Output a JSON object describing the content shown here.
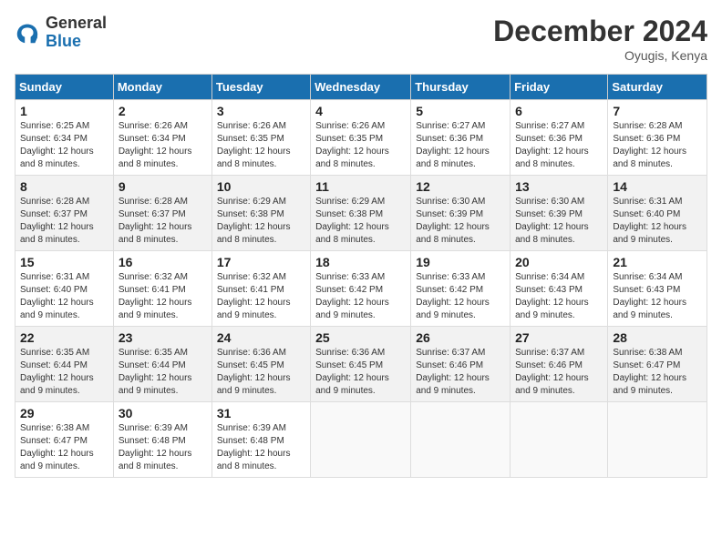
{
  "logo": {
    "general": "General",
    "blue": "Blue"
  },
  "title": "December 2024",
  "location": "Oyugis, Kenya",
  "days_of_week": [
    "Sunday",
    "Monday",
    "Tuesday",
    "Wednesday",
    "Thursday",
    "Friday",
    "Saturday"
  ],
  "weeks": [
    [
      {
        "day": "1",
        "sunrise": "6:25 AM",
        "sunset": "6:34 PM",
        "daylight": "12 hours and 8 minutes."
      },
      {
        "day": "2",
        "sunrise": "6:26 AM",
        "sunset": "6:34 PM",
        "daylight": "12 hours and 8 minutes."
      },
      {
        "day": "3",
        "sunrise": "6:26 AM",
        "sunset": "6:35 PM",
        "daylight": "12 hours and 8 minutes."
      },
      {
        "day": "4",
        "sunrise": "6:26 AM",
        "sunset": "6:35 PM",
        "daylight": "12 hours and 8 minutes."
      },
      {
        "day": "5",
        "sunrise": "6:27 AM",
        "sunset": "6:36 PM",
        "daylight": "12 hours and 8 minutes."
      },
      {
        "day": "6",
        "sunrise": "6:27 AM",
        "sunset": "6:36 PM",
        "daylight": "12 hours and 8 minutes."
      },
      {
        "day": "7",
        "sunrise": "6:28 AM",
        "sunset": "6:36 PM",
        "daylight": "12 hours and 8 minutes."
      }
    ],
    [
      {
        "day": "8",
        "sunrise": "6:28 AM",
        "sunset": "6:37 PM",
        "daylight": "12 hours and 8 minutes."
      },
      {
        "day": "9",
        "sunrise": "6:28 AM",
        "sunset": "6:37 PM",
        "daylight": "12 hours and 8 minutes."
      },
      {
        "day": "10",
        "sunrise": "6:29 AM",
        "sunset": "6:38 PM",
        "daylight": "12 hours and 8 minutes."
      },
      {
        "day": "11",
        "sunrise": "6:29 AM",
        "sunset": "6:38 PM",
        "daylight": "12 hours and 8 minutes."
      },
      {
        "day": "12",
        "sunrise": "6:30 AM",
        "sunset": "6:39 PM",
        "daylight": "12 hours and 8 minutes."
      },
      {
        "day": "13",
        "sunrise": "6:30 AM",
        "sunset": "6:39 PM",
        "daylight": "12 hours and 8 minutes."
      },
      {
        "day": "14",
        "sunrise": "6:31 AM",
        "sunset": "6:40 PM",
        "daylight": "12 hours and 9 minutes."
      }
    ],
    [
      {
        "day": "15",
        "sunrise": "6:31 AM",
        "sunset": "6:40 PM",
        "daylight": "12 hours and 9 minutes."
      },
      {
        "day": "16",
        "sunrise": "6:32 AM",
        "sunset": "6:41 PM",
        "daylight": "12 hours and 9 minutes."
      },
      {
        "day": "17",
        "sunrise": "6:32 AM",
        "sunset": "6:41 PM",
        "daylight": "12 hours and 9 minutes."
      },
      {
        "day": "18",
        "sunrise": "6:33 AM",
        "sunset": "6:42 PM",
        "daylight": "12 hours and 9 minutes."
      },
      {
        "day": "19",
        "sunrise": "6:33 AM",
        "sunset": "6:42 PM",
        "daylight": "12 hours and 9 minutes."
      },
      {
        "day": "20",
        "sunrise": "6:34 AM",
        "sunset": "6:43 PM",
        "daylight": "12 hours and 9 minutes."
      },
      {
        "day": "21",
        "sunrise": "6:34 AM",
        "sunset": "6:43 PM",
        "daylight": "12 hours and 9 minutes."
      }
    ],
    [
      {
        "day": "22",
        "sunrise": "6:35 AM",
        "sunset": "6:44 PM",
        "daylight": "12 hours and 9 minutes."
      },
      {
        "day": "23",
        "sunrise": "6:35 AM",
        "sunset": "6:44 PM",
        "daylight": "12 hours and 9 minutes."
      },
      {
        "day": "24",
        "sunrise": "6:36 AM",
        "sunset": "6:45 PM",
        "daylight": "12 hours and 9 minutes."
      },
      {
        "day": "25",
        "sunrise": "6:36 AM",
        "sunset": "6:45 PM",
        "daylight": "12 hours and 9 minutes."
      },
      {
        "day": "26",
        "sunrise": "6:37 AM",
        "sunset": "6:46 PM",
        "daylight": "12 hours and 9 minutes."
      },
      {
        "day": "27",
        "sunrise": "6:37 AM",
        "sunset": "6:46 PM",
        "daylight": "12 hours and 9 minutes."
      },
      {
        "day": "28",
        "sunrise": "6:38 AM",
        "sunset": "6:47 PM",
        "daylight": "12 hours and 9 minutes."
      }
    ],
    [
      {
        "day": "29",
        "sunrise": "6:38 AM",
        "sunset": "6:47 PM",
        "daylight": "12 hours and 9 minutes."
      },
      {
        "day": "30",
        "sunrise": "6:39 AM",
        "sunset": "6:48 PM",
        "daylight": "12 hours and 8 minutes."
      },
      {
        "day": "31",
        "sunrise": "6:39 AM",
        "sunset": "6:48 PM",
        "daylight": "12 hours and 8 minutes."
      },
      null,
      null,
      null,
      null
    ]
  ]
}
